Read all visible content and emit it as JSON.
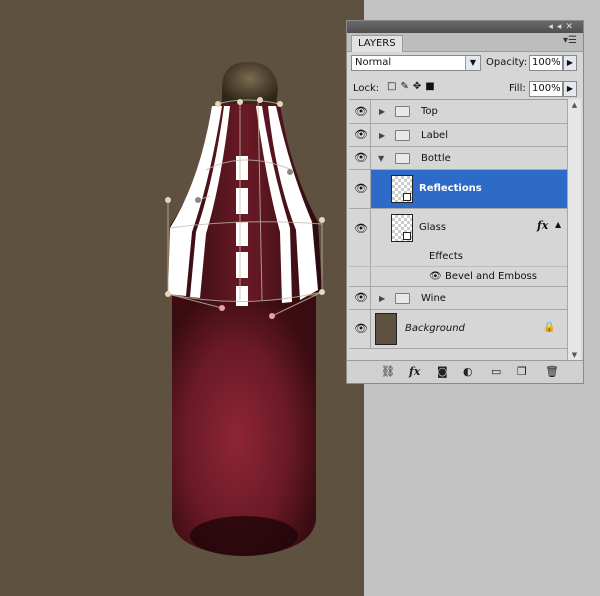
{
  "colors": {
    "canvas_bg": "#5e5140",
    "selection": "#2e6ac8",
    "wine": "#7e1f2b",
    "panel": "#d6d6d6"
  },
  "panel": {
    "title_tab": "LAYERS",
    "blend_mode": "Normal",
    "opacity_label": "Opacity:",
    "opacity_value": "100%",
    "lock_label": "Lock:",
    "fill_label": "Fill:",
    "fill_value": "100%"
  },
  "layers": {
    "top": "Top",
    "label": "Label",
    "bottle": "Bottle",
    "reflections": "Reflections",
    "glass": "Glass",
    "effects": "Effects",
    "bevel": "Bevel and Emboss",
    "wine": "Wine",
    "background": "Background"
  }
}
